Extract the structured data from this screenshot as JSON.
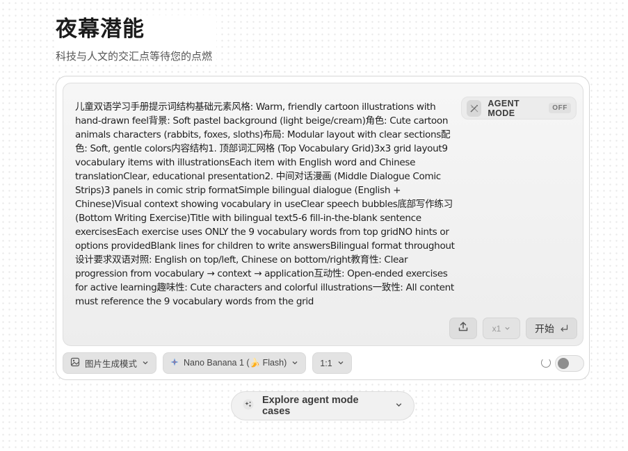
{
  "header": {
    "title": "夜幕潜能",
    "subtitle": "科技与人文的交汇点等待您的点燃"
  },
  "editor": {
    "prompt": "儿童双语学习手册提示词结构基础元素风格: Warm, friendly cartoon illustrations with hand-drawn feel背景: Soft pastel background (light beige/cream)角色: Cute cartoon animals characters (rabbits, foxes, sloths)布局: Modular layout with clear sections配色: Soft, gentle colors内容结构1. 顶部词汇网格 (Top Vocabulary Grid)3x3 grid layout9 vocabulary items with illustrationsEach item with English word and Chinese translationClear, educational presentation2. 中间对话漫画 (Middle Dialogue Comic Strips)3 panels in comic strip formatSimple bilingual dialogue (English + Chinese)Visual context showing vocabulary in useClear speech bubbles底部写作练习 (Bottom Writing Exercise)Title with bilingual text5-6 fill-in-the-blank sentence exercisesEach exercise uses ONLY the 9 vocabulary words from top gridNO hints or options providedBlank lines for children to write answersBilingual format throughout设计要求双语对照: English on top/left, Chinese on bottom/right教育性: Clear progression from vocabulary → context → application互动性: Open-ended exercises for active learning趣味性: Cute characters and colorful illustrations一致性: All content must reference the 9 vocabulary words from the grid",
    "agent_mode": {
      "label": "AGENT MODE",
      "state": "OFF",
      "icon": "magic-wand-icon"
    },
    "count_label": "x1",
    "start_label": "开始"
  },
  "toolbar": {
    "mode_label": "图片生成模式",
    "model_label": "Nano Banana 1 (🍌 Flash)",
    "ratio_label": "1:1"
  },
  "explore": {
    "label": "Explore agent mode cases"
  },
  "colors": {
    "accent_star": "#4a8fe8",
    "background": "#ffffff",
    "editor_bg": "#f2f2f2"
  }
}
